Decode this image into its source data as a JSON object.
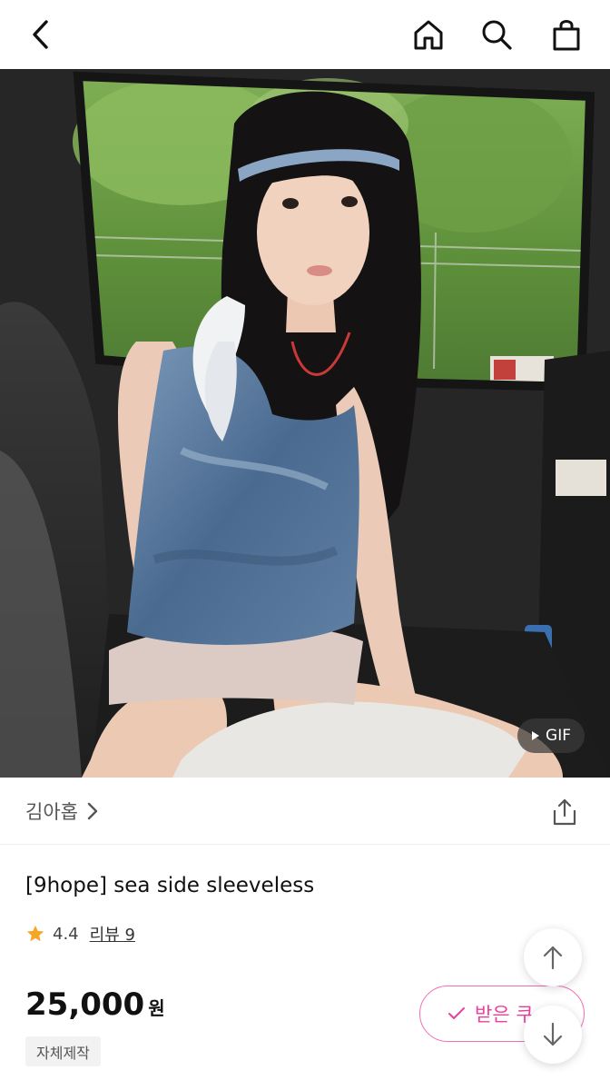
{
  "topbar": {
    "back_icon": "chevron-left-icon",
    "home_icon": "home-icon",
    "search_icon": "search-icon",
    "bag_icon": "shopping-bag-icon"
  },
  "media": {
    "gif_label": "GIF",
    "gif_icon": "play-triangle-icon"
  },
  "seller": {
    "name": "김아홉",
    "chevron_icon": "chevron-right-icon",
    "share_icon": "share-icon"
  },
  "product": {
    "title": "[9hope] sea side sleeveless",
    "rating": "4.4",
    "star_icon": "star-icon",
    "review_label": "리뷰 9",
    "price": "25,000",
    "price_unit": "원",
    "tag": "자체제작"
  },
  "coupon": {
    "label": "받은 쿠",
    "icon": "checkmark-icon"
  },
  "scroll": {
    "up_icon": "arrow-up-icon",
    "down_icon": "arrow-down-icon"
  },
  "colors": {
    "accent_pink": "#ea3f9b",
    "star": "#f5a623",
    "divider": "#eeeeee"
  }
}
